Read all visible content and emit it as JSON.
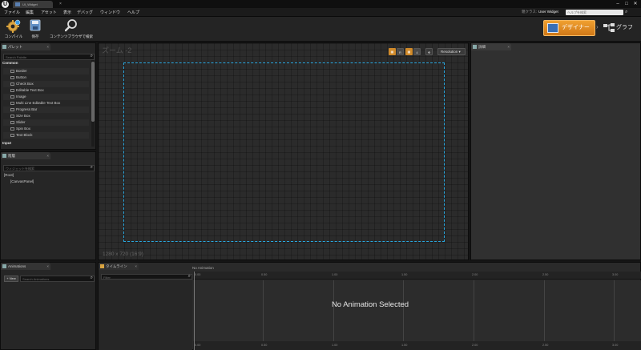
{
  "window": {
    "tab_title": "UI_Widget",
    "tab_close": "×",
    "minimize": "–",
    "maximize": "□",
    "close": "✕"
  },
  "menu": {
    "items": [
      "ファイル",
      "編集",
      "アセット",
      "表示",
      "デバッグ",
      "ウィンドウ",
      "ヘルプ"
    ],
    "parent_label": "親クラス:",
    "parent_value": "User Widget",
    "help_placeholder": "ヘルプを検索"
  },
  "toolbar": {
    "compile": "コンパイル",
    "save": "保存",
    "browse": "コンテンツブラウザで検索",
    "designer": "デザイナー",
    "graph": "グラフ"
  },
  "palette": {
    "title": "パレット",
    "search_placeholder": "Search Palette",
    "category_common": "Common",
    "items": [
      "Border",
      "Button",
      "Check Box",
      "Editable Text Box",
      "Image",
      "Multi Line Editable Text Box",
      "Progress Bar",
      "Size Box",
      "Slider",
      "Spin Box",
      "Text Block"
    ],
    "category_input": "Input"
  },
  "hierarchy": {
    "title": "階層",
    "search_placeholder": "ウィジェットを検索",
    "root": "[Root]",
    "child": "[CanvasPanel]"
  },
  "animations": {
    "title": "Animations",
    "new_label": "+ New",
    "search_placeholder": "Search Animations"
  },
  "designer": {
    "zoom": "ズーム -2",
    "resolution_text": "1280 x 720 (16:9)",
    "resolution_button": "Resolution ▾",
    "btn_r": "R",
    "btn_4": "4"
  },
  "details": {
    "title": "詳細"
  },
  "timeline": {
    "title": "タイムライン",
    "no_anim_label": "No Animation",
    "search_placeholder": "Filter",
    "message": "No Animation Selected",
    "ticks": [
      "0.00",
      "0.50",
      "1.00",
      "1.50",
      "2.00",
      "2.50",
      "3.00"
    ]
  },
  "colors": {
    "accent": "#e8902a",
    "safe_frame": "#29a8e0",
    "background": "#262626"
  }
}
